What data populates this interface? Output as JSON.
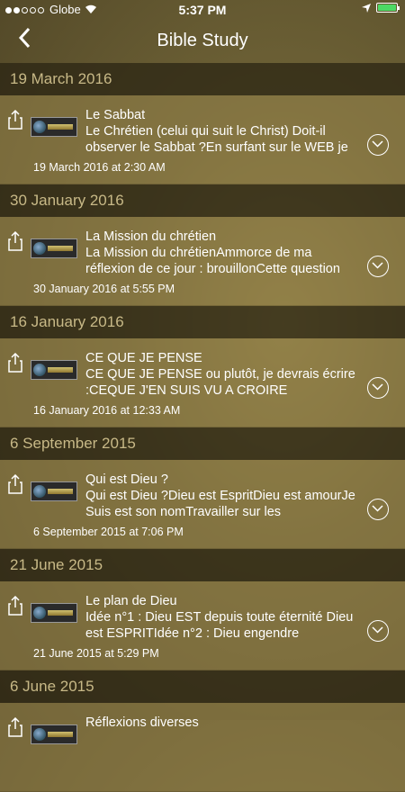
{
  "status_bar": {
    "carrier": "Globe",
    "time": "5:37 PM"
  },
  "nav": {
    "title": "Bible Study"
  },
  "sections": [
    {
      "header": "19 March 2016",
      "title": "Le Sabbat",
      "snippet": "Le Chrétien (celui qui suit le Christ) Doit-il observer le Sabbat ?En surfant sur le WEB je",
      "date": "19 March 2016 at 2:30 AM"
    },
    {
      "header": "30 January 2016",
      "title": "La Mission du chrétien",
      "snippet": "La Mission du chrétienAmmorce de ma réflexion de ce jour : brouillonCette question",
      "date": "30 January 2016 at 5:55 PM"
    },
    {
      "header": "16 January 2016",
      "title": "CE QUE JE PENSE",
      "snippet": "CE QUE JE PENSE ou plutôt, je devrais écrire :CEQUE J'EN SUIS VU A CROIRE",
      "date": "16 January 2016 at 12:33 AM"
    },
    {
      "header": "6 September 2015",
      "title": "Qui est Dieu ?",
      "snippet": "Qui est Dieu ?Dieu est EspritDieu est amourJe Suis est son nomTravailler sur les",
      "date": "6 September 2015 at 7:06 PM"
    },
    {
      "header": "21 June 2015",
      "title": "Le plan de Dieu",
      "snippet": "Idée n°1 : Dieu EST depuis toute éternité Dieu est ESPRITIdée n°2 : Dieu engendre",
      "date": "21 June 2015 at 5:29 PM"
    },
    {
      "header": "6 June 2015",
      "title": "Réflexions diverses",
      "snippet": "",
      "date": ""
    }
  ]
}
